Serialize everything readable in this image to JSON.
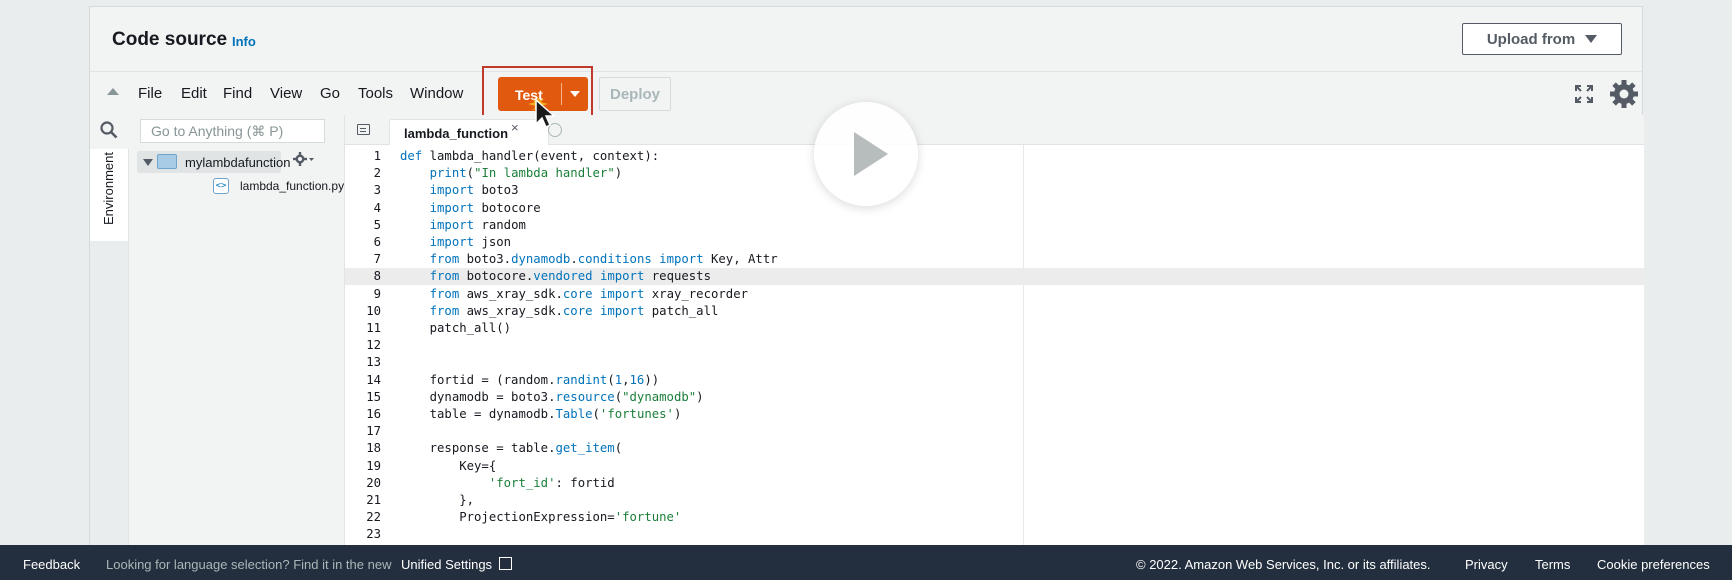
{
  "header": {
    "title": "Code source",
    "info_link": "Info",
    "upload_label": "Upload from"
  },
  "menu": {
    "items": [
      "File",
      "Edit",
      "Find",
      "View",
      "Go",
      "Tools",
      "Window"
    ],
    "test_label": "Test",
    "deploy_label": "Deploy"
  },
  "sidebar": {
    "search_placeholder": "Go to Anything (⌘ P)",
    "environment_tab": "Environment",
    "folder_name": "mylambdafunction",
    "file_name": "lambda_function.py"
  },
  "editor": {
    "tab_label": "lambda_function",
    "tab_close": "×",
    "active_line": 8,
    "lines": [
      {
        "n": "1",
        "html": "<span class=\"kw\">def</span> lambda_handler(event, context):"
      },
      {
        "n": "2",
        "html": "    <span class=\"fn\">print</span>(<span class=\"str\">\"In lambda handler\"</span>)"
      },
      {
        "n": "3",
        "html": "    <span class=\"kw\">import</span> boto3"
      },
      {
        "n": "4",
        "html": "    <span class=\"kw\">import</span> botocore"
      },
      {
        "n": "5",
        "html": "    <span class=\"kw\">import</span> random"
      },
      {
        "n": "6",
        "html": "    <span class=\"kw\">import</span> json"
      },
      {
        "n": "7",
        "html": "    <span class=\"kw\">from</span> boto3.<span class=\"fn\">dynamodb</span>.<span class=\"fn\">conditions</span> <span class=\"kw\">import</span> Key, Attr"
      },
      {
        "n": "8",
        "html": "    <span class=\"kw\">from</span> botocore.<span class=\"fn\">vendored</span> <span class=\"kw\">import</span> requests"
      },
      {
        "n": "9",
        "html": "    <span class=\"kw\">from</span> aws_xray_sdk.<span class=\"fn\">core</span> <span class=\"kw\">import</span> xray_recorder"
      },
      {
        "n": "10",
        "html": "    <span class=\"kw\">from</span> aws_xray_sdk.<span class=\"fn\">core</span> <span class=\"kw\">import</span> patch_all"
      },
      {
        "n": "11",
        "html": "    patch_all()"
      },
      {
        "n": "12",
        "html": ""
      },
      {
        "n": "13",
        "html": ""
      },
      {
        "n": "14",
        "html": "    fortid = (random.<span class=\"fn\">randint</span>(<span class=\"num\">1</span>,<span class=\"num\">16</span>))"
      },
      {
        "n": "15",
        "html": "    dynamodb = boto3.<span class=\"fn\">resource</span>(<span class=\"str\">\"dynamodb\"</span>)"
      },
      {
        "n": "16",
        "html": "    table = dynamodb.<span class=\"fn\">Table</span>(<span class=\"str\">'fortunes'</span>)"
      },
      {
        "n": "17",
        "html": ""
      },
      {
        "n": "18",
        "html": "    response = table.<span class=\"fn\">get_item</span>("
      },
      {
        "n": "19",
        "html": "        Key={"
      },
      {
        "n": "20",
        "html": "            <span class=\"str\">'fort_id'</span>: fortid"
      },
      {
        "n": "21",
        "html": "        },"
      },
      {
        "n": "22",
        "html": "        ProjectionExpression=<span class=\"str\">'fortune'</span>"
      },
      {
        "n": "23",
        "html": ""
      }
    ]
  },
  "footer": {
    "feedback": "Feedback",
    "language_prompt": "Looking for language selection? Find it in the new",
    "unified_settings": "Unified Settings",
    "copyright": "© 2022. Amazon Web Services, Inc. or its affiliates.",
    "privacy": "Privacy",
    "terms": "Terms",
    "cookie": "Cookie preferences"
  },
  "colors": {
    "accent_orange": "#e1590f",
    "link_blue": "#0073bb",
    "footer_bg": "#232f3e",
    "highlight_red": "#c0392b"
  }
}
